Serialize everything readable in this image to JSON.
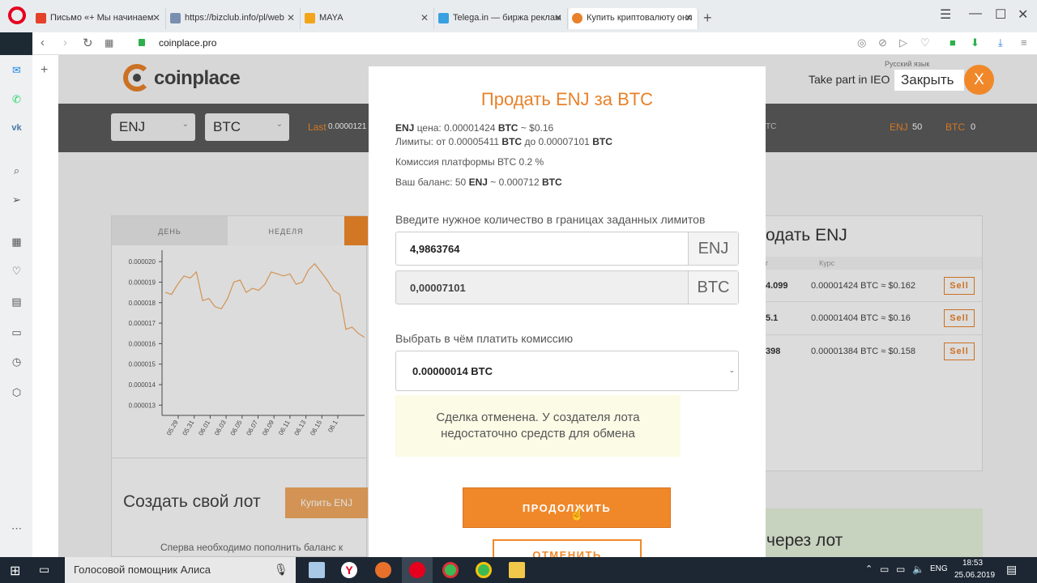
{
  "browser": {
    "tabs": [
      {
        "title": "Письмо «+ Мы начинаем",
        "fav_color": "#e4412b"
      },
      {
        "title": "https://bizclub.info/pl/web",
        "fav_color": "#7a8fb0"
      },
      {
        "title": "MAYA",
        "fav_color": "#f2a51a"
      },
      {
        "title": "Telega.in — биржа реклам",
        "fav_color": "#3aa0e0"
      },
      {
        "title": "Купить криптовалюту онл",
        "fav_color": "#e8812a"
      }
    ],
    "url": "coinplace.pro",
    "new_tab": "+"
  },
  "site": {
    "logo_text": "coinplace",
    "lang": "Русский язык",
    "ieo_link": "Take part in IEO",
    "bar": {
      "sel1": "ENJ",
      "sel2": "BTC",
      "last_label": "Last",
      "last_value": "0.0000121",
      "bal1_cur": "ENJ",
      "bal1_val": "50",
      "bal2_cur": "BTC",
      "bal2_val": "0",
      "tc_fragment": "ТС"
    },
    "chart_tabs": [
      "ДЕНЬ",
      "НЕДЕЛЯ"
    ],
    "create_lot_title": "Создать свой лот",
    "buy_btn": "Купить ENJ",
    "hint": "Сперва необходимо пополнить баланс к",
    "right_title": "одать ENJ",
    "right_col": "Курс",
    "right_col_frag": "г",
    "right_rows": [
      {
        "amount": "4.099",
        "rate": "0.00001424 BTC ≈ $0.162"
      },
      {
        "amount": "5.1",
        "rate": "0.00001404 BTC ≈ $0.16"
      },
      {
        "amount": "398",
        "rate": "0.00001384 BTC ≈ $0.158"
      }
    ],
    "sell_label": "Sell",
    "via_lot": "через лот"
  },
  "chart_data": {
    "type": "line",
    "x": [
      "05.29",
      "05.31",
      "06.01",
      "06.03",
      "06.05",
      "06.07",
      "06.09",
      "06.11",
      "06.13",
      "06.15",
      "06.1"
    ],
    "yticks": [
      "0.000020",
      "0.000019",
      "0.000018",
      "0.000017",
      "0.000016",
      "0.000015",
      "0.000014",
      "0.000013"
    ],
    "ylim": [
      1.25e-05,
      2.04e-05
    ],
    "series": [
      {
        "values": [
          1.85e-05,
          1.84e-05,
          1.89e-05,
          1.93e-05,
          1.92e-05,
          1.95e-05,
          1.81e-05,
          1.82e-05,
          1.78e-05,
          1.77e-05,
          1.82e-05,
          1.9e-05,
          1.91e-05,
          1.85e-05,
          1.87e-05,
          1.86e-05,
          1.89e-05,
          1.95e-05,
          1.94e-05,
          1.93e-05,
          1.94e-05,
          1.89e-05,
          1.9e-05,
          1.96e-05,
          1.99e-05,
          1.95e-05,
          1.91e-05,
          1.86e-05,
          1.84e-05,
          1.67e-05,
          1.68e-05,
          1.65e-05,
          1.63e-05
        ]
      }
    ],
    "color": "#f0a860"
  },
  "modal": {
    "title": "Продать ENJ за BTC",
    "price_cur": "ENJ",
    "price_text": "цена: 0.00001424",
    "price_btc": "BTC",
    "price_usd": "~ $0.16",
    "limits_text": "Лимиты: от 0.00005411",
    "limits_btc1": "BTC",
    "limits_mid": "до 0.00007101",
    "limits_btc2": "BTC",
    "fee_text": "Комиссия платформы ВТС 0.2 %",
    "balance_text": "Ваш баланс: 50",
    "balance_enj": "ENJ",
    "balance_mid": "~ 0.000712",
    "balance_btc": "BTC",
    "amount_label": "Введите нужное количество в границах заданных лимитов",
    "amount_value": "4,9863764",
    "amount_cur": "ENJ",
    "btc_value": "0,00007101",
    "btc_cur": "BTC",
    "fee_label": "Выбрать в чём платить комиссию",
    "fee_value": "0.00000014 BTC",
    "notice_line1": "Сделка отменена. У создателя лота",
    "notice_line2": "недостаточно средств для обмена",
    "continue_btn": "ПРОДОЛЖИТЬ",
    "cancel_btn": "ОТМЕНИТЬ",
    "close_label": "Закрыть",
    "close_x": "X"
  },
  "taskbar": {
    "search": "Голосовой помощник Алиса",
    "lang": "ENG",
    "time": "18:53",
    "date": "25.06.2019"
  },
  "colors": {
    "accent": "#f0882a",
    "brand_orange": "#e8812a"
  }
}
